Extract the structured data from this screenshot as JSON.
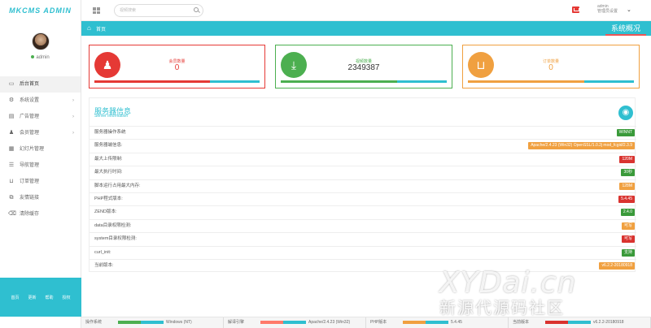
{
  "brand": {
    "logo_text": "MKCMS ADMIN"
  },
  "profile": {
    "name": "admin"
  },
  "sidebar": {
    "items": [
      {
        "label": "后台首页",
        "icon": "monitor-icon",
        "active": true,
        "expandable": false
      },
      {
        "label": "系统设置",
        "icon": "gear-icon",
        "active": false,
        "expandable": true
      },
      {
        "label": "广告管理",
        "icon": "ad-icon",
        "active": false,
        "expandable": true
      },
      {
        "label": "会员管理",
        "icon": "users-icon",
        "active": false,
        "expandable": true
      },
      {
        "label": "幻灯片管理",
        "icon": "slides-icon",
        "active": false,
        "expandable": false
      },
      {
        "label": "导航管理",
        "icon": "nav-icon",
        "active": false,
        "expandable": false
      },
      {
        "label": "订单管理",
        "icon": "cart-icon",
        "active": false,
        "expandable": false
      },
      {
        "label": "友情链接",
        "icon": "link-icon",
        "active": false,
        "expandable": false
      },
      {
        "label": "清除缓存",
        "icon": "trash-icon",
        "active": false,
        "expandable": false
      }
    ],
    "footer_links": [
      "首页",
      "更新",
      "帮助",
      "授权"
    ]
  },
  "header": {
    "search_placeholder": "视频搜索",
    "user_name": "admin",
    "user_role": "管理员设置"
  },
  "breadcrumb": {
    "home": "首页",
    "section_tab": "系统概况"
  },
  "stats": [
    {
      "label": "会员数量",
      "value": "0",
      "color": "#e53935",
      "icon": "users-icon",
      "progress": 0.7
    },
    {
      "label": "视频数量",
      "value": "2349387",
      "color": "#4caf50",
      "icon": "download-icon",
      "progress": 0.7
    },
    {
      "label": "订单数量",
      "value": "0",
      "color": "#f0a040",
      "icon": "cart-icon",
      "progress": 0.7
    }
  ],
  "server": {
    "title": "服务器信息",
    "subtitle": "Server Information",
    "rows": [
      {
        "label": "服务器操作系统",
        "value": "WINNT",
        "color": "#3a9a3a"
      },
      {
        "label": "服务器端信息:",
        "value": "Apache/2.4.23 (Win32) OpenSSL/1.0.2j mod_fcgid/2.3.9",
        "color": "#f0a040"
      },
      {
        "label": "最大上传限制:",
        "value": "120M",
        "color": "#d9332f"
      },
      {
        "label": "最大执行时间:",
        "value": "30秒",
        "color": "#3a9a3a"
      },
      {
        "label": "脚本运行占用最大内存:",
        "value": "128M",
        "color": "#f0a040"
      },
      {
        "label": "PHP程式版本:",
        "value": "5.4.45",
        "color": "#d9332f"
      },
      {
        "label": "ZEND版本:",
        "value": "2.4.0",
        "color": "#3a9a3a"
      },
      {
        "label": "data目录权限检测:",
        "value": "可写",
        "color": "#f0a040"
      },
      {
        "label": "system目录权限检测:",
        "value": "可写",
        "color": "#d9332f"
      },
      {
        "label": "curl_init:",
        "value": "支持",
        "color": "#3a9a3a"
      },
      {
        "label": "当前版本:",
        "value": "v6.2.2-20180918",
        "color": "#f0a040"
      }
    ]
  },
  "statusbar": [
    {
      "label": "操作系统",
      "value": "Windows (NT)",
      "color_a": "#4caf50",
      "color_b": "#2fbfd0"
    },
    {
      "label": "解译引擎",
      "value": "Apache/2.4.23 (Win32)",
      "color_a": "#ff7a6a",
      "color_b": "#2fbfd0"
    },
    {
      "label": "PHP版本",
      "value": "5.4.45",
      "color_a": "#f0a040",
      "color_b": "#2fbfd0"
    },
    {
      "label": "当前版本",
      "value": "v6.2.2-20180918",
      "color_a": "#d9332f",
      "color_b": "#2fbfd0"
    }
  ],
  "watermark": {
    "line1": "XYDai.cn",
    "line2": "新源代源码社区"
  }
}
